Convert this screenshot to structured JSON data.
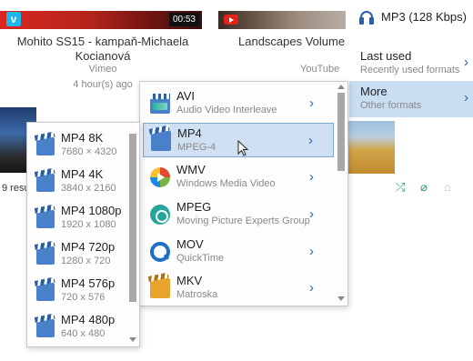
{
  "videos": [
    {
      "badge": "v",
      "duration": "00:53",
      "title_line1": "Mohito SS15 - kampaň-Michaela",
      "title_line2": "Kocianová",
      "source": "Vimeo",
      "age": "4 hour(s) ago"
    },
    {
      "title_line1": "Landscapes Volume",
      "source": "YouTube"
    }
  ],
  "results_text": "9 resu",
  "output": {
    "label": "MP3 (128 Kbps)",
    "icon": "headphones-icon"
  },
  "categories": [
    {
      "title": "Last used",
      "subtitle": "Recently used formats"
    },
    {
      "title": "More",
      "subtitle": "Other formats"
    }
  ],
  "formats": [
    {
      "name": "AVI",
      "desc": "Audio Video Interleave",
      "icon": "avi-icon"
    },
    {
      "name": "MP4",
      "desc": "MPEG-4",
      "icon": "mp4-icon",
      "selected": true
    },
    {
      "name": "WMV",
      "desc": "Windows Media Video",
      "icon": "wmv-icon"
    },
    {
      "name": "MPEG",
      "desc": "Moving Picture Experts Group",
      "icon": "mpeg-icon"
    },
    {
      "name": "MOV",
      "desc": "QuickTime",
      "icon": "quicktime-icon"
    },
    {
      "name": "MKV",
      "desc": "Matroska",
      "icon": "mkv-icon"
    }
  ],
  "resolutions": [
    {
      "name": "MP4 8K",
      "size": "7680 × 4320"
    },
    {
      "name": "MP4 4K",
      "size": "3840 x 2160"
    },
    {
      "name": "MP4 1080p",
      "size": "1920 x 1080"
    },
    {
      "name": "MP4 720p",
      "size": "1280 x 720"
    },
    {
      "name": "MP4 576p",
      "size": "720 x 576"
    },
    {
      "name": "MP4 480p",
      "size": "640 x 480"
    }
  ],
  "colors": {
    "accent": "#2b5fa8",
    "selected_bg": "#cfe0f3",
    "category_selected_bg": "#c9def1",
    "action_green": "#2aa36b"
  }
}
